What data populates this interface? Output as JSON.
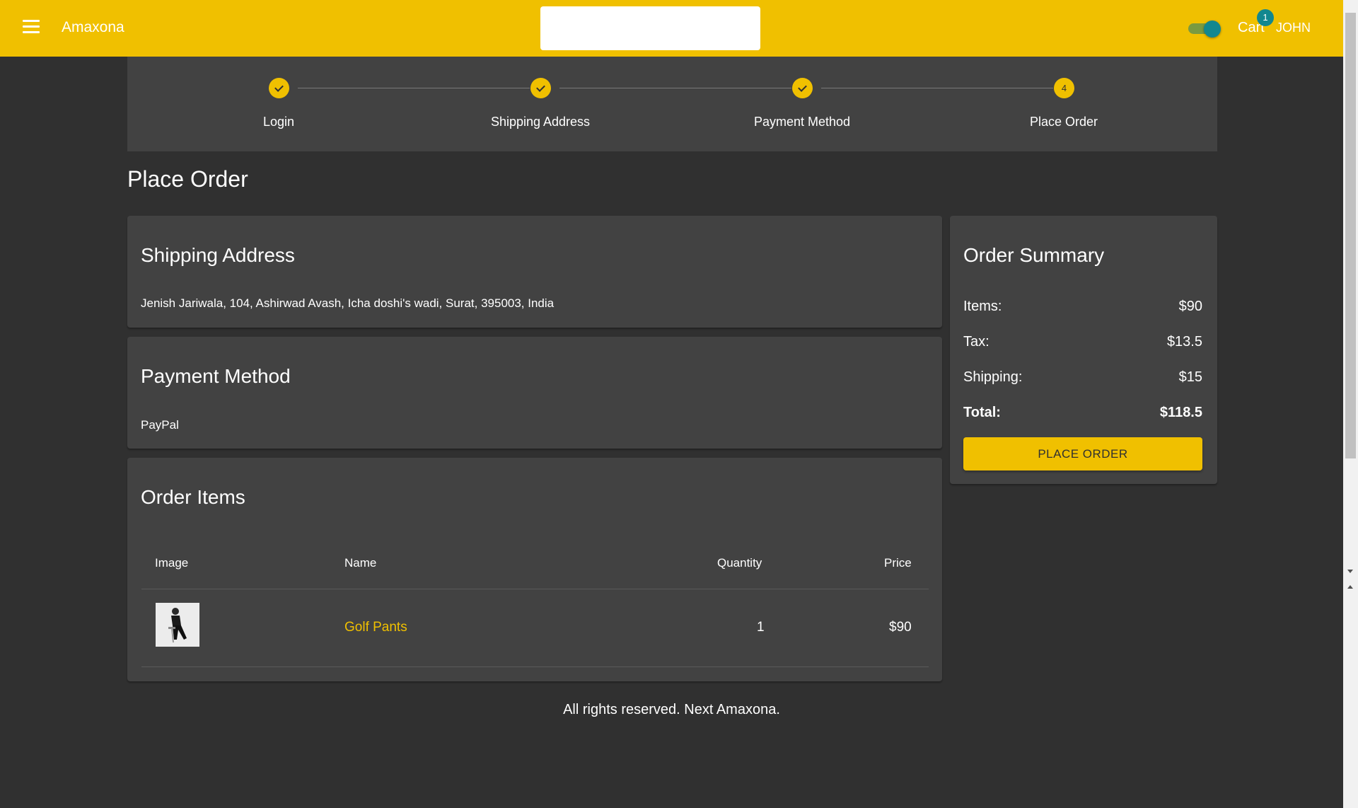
{
  "appbar": {
    "brand": "Amaxona",
    "search_placeholder": "",
    "cart_label": "Cart",
    "cart_count": "1",
    "user_name": "JOHN"
  },
  "stepper": {
    "steps": [
      {
        "label": "Login",
        "status": "completed"
      },
      {
        "label": "Shipping Address",
        "status": "completed"
      },
      {
        "label": "Payment Method",
        "status": "completed"
      },
      {
        "label": "Place Order",
        "status": "active",
        "number": "4"
      }
    ]
  },
  "page_title": "Place Order",
  "shipping": {
    "heading": "Shipping Address",
    "address": "Jenish Jariwala, 104, Ashirwad Avash, Icha doshi's wadi, Surat, 395003, India"
  },
  "payment": {
    "heading": "Payment Method",
    "method": "PayPal"
  },
  "order_items": {
    "heading": "Order Items",
    "columns": [
      "Image",
      "Name",
      "Quantity",
      "Price"
    ],
    "rows": [
      {
        "name": "Golf Pants",
        "quantity": "1",
        "price": "$90"
      }
    ]
  },
  "summary": {
    "heading": "Order Summary",
    "items_label": "Items:",
    "items_value": "$90",
    "tax_label": "Tax:",
    "tax_value": "$13.5",
    "shipping_label": "Shipping:",
    "shipping_value": "$15",
    "total_label": "Total:",
    "total_value": "$118.5",
    "button_label": "PLACE ORDER"
  },
  "footer": "All rights reserved. Next Amaxona.",
  "colors": {
    "primary": "#f0c000",
    "secondary": "#12878f",
    "background": "#303030",
    "paper": "#424242"
  }
}
